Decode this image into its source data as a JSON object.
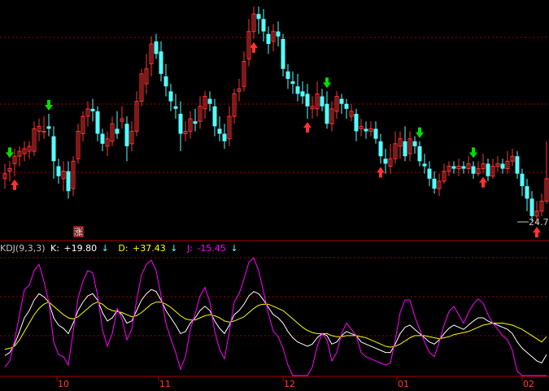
{
  "kdj": {
    "header": "KDJ(9,3,3)",
    "k_label": "K:",
    "k_value": "+19.80",
    "d_label": "D:",
    "d_value": "+37.43",
    "j_label": "J:",
    "j_value": "-15.45",
    "colors": {
      "k": "#ffffff",
      "d": "#ffff00",
      "j": "#ff00ff",
      "text": "#c0c0c0"
    }
  },
  "price": {
    "last_low_label": "24.7",
    "badge": "涨",
    "colors": {
      "up": "#ff3232",
      "down": "#54ffff",
      "buy_arrow": "#ff3232",
      "sell_arrow": "#00e000",
      "grid": "#a00000"
    }
  },
  "axis": {
    "months": [
      "10",
      "11",
      "12",
      "01",
      "02"
    ],
    "month_color": "#ff3c3c"
  },
  "chart_data": [
    {
      "type": "candlestick",
      "title": "",
      "candles": [
        {
          "o": 207,
          "c": 209,
          "h": 213,
          "l": 203
        },
        {
          "o": 210,
          "c": 211,
          "h": 214,
          "l": 206
        },
        {
          "o": 213,
          "c": 216,
          "h": 219,
          "l": 208
        },
        {
          "o": 216,
          "c": 218,
          "h": 220,
          "l": 212
        },
        {
          "o": 217,
          "c": 219,
          "h": 222,
          "l": 214
        },
        {
          "o": 218,
          "c": 220,
          "h": 222,
          "l": 215
        },
        {
          "o": 218,
          "c": 227,
          "h": 230,
          "l": 216
        },
        {
          "o": 226,
          "c": 228,
          "h": 231,
          "l": 222
        },
        {
          "o": 226,
          "c": 226,
          "h": 232,
          "l": 223
        },
        {
          "o": 228,
          "c": 227,
          "h": 233,
          "l": 224
        },
        {
          "o": 224,
          "c": 214,
          "h": 228,
          "l": 207
        },
        {
          "o": 212,
          "c": 208,
          "h": 215,
          "l": 205
        },
        {
          "o": 207,
          "c": 210,
          "h": 214,
          "l": 202
        },
        {
          "o": 210,
          "c": 202,
          "h": 214,
          "l": 199
        },
        {
          "o": 203,
          "c": 214,
          "h": 216,
          "l": 200
        },
        {
          "o": 215,
          "c": 226,
          "h": 229,
          "l": 213
        },
        {
          "o": 225,
          "c": 232,
          "h": 234,
          "l": 222
        },
        {
          "o": 232,
          "c": 235,
          "h": 238,
          "l": 228
        },
        {
          "o": 235,
          "c": 234,
          "h": 239,
          "l": 230
        },
        {
          "o": 234,
          "c": 225,
          "h": 236,
          "l": 222
        },
        {
          "o": 225,
          "c": 221,
          "h": 227,
          "l": 218
        },
        {
          "o": 220,
          "c": 223,
          "h": 226,
          "l": 216
        },
        {
          "o": 222,
          "c": 229,
          "h": 232,
          "l": 220
        },
        {
          "o": 227,
          "c": 225,
          "h": 234,
          "l": 223
        },
        {
          "o": 230,
          "c": 231,
          "h": 236,
          "l": 227
        },
        {
          "o": 229,
          "c": 220,
          "h": 232,
          "l": 214
        },
        {
          "o": 221,
          "c": 226,
          "h": 230,
          "l": 218
        },
        {
          "o": 226,
          "c": 238,
          "h": 242,
          "l": 224
        },
        {
          "o": 238,
          "c": 249,
          "h": 251,
          "l": 236
        },
        {
          "o": 245,
          "c": 251,
          "h": 257,
          "l": 241
        },
        {
          "o": 253,
          "c": 261,
          "h": 264,
          "l": 248
        },
        {
          "o": 262,
          "c": 257,
          "h": 265,
          "l": 255
        },
        {
          "o": 258,
          "c": 249,
          "h": 262,
          "l": 246
        },
        {
          "o": 248,
          "c": 244,
          "h": 253,
          "l": 240
        },
        {
          "o": 242,
          "c": 238,
          "h": 245,
          "l": 234
        },
        {
          "o": 236,
          "c": 235,
          "h": 241,
          "l": 231
        },
        {
          "o": 233,
          "c": 225,
          "h": 238,
          "l": 218
        },
        {
          "o": 225,
          "c": 226,
          "h": 230,
          "l": 222
        },
        {
          "o": 226,
          "c": 231,
          "h": 234,
          "l": 223
        },
        {
          "o": 230,
          "c": 229,
          "h": 235,
          "l": 226
        },
        {
          "o": 230,
          "c": 236,
          "h": 240,
          "l": 227
        },
        {
          "o": 235,
          "c": 240,
          "h": 242,
          "l": 231
        },
        {
          "o": 239,
          "c": 237,
          "h": 242,
          "l": 234
        },
        {
          "o": 236,
          "c": 228,
          "h": 239,
          "l": 224
        },
        {
          "o": 227,
          "c": 225,
          "h": 232,
          "l": 222
        },
        {
          "o": 225,
          "c": 222,
          "h": 229,
          "l": 219
        },
        {
          "o": 223,
          "c": 232,
          "h": 236,
          "l": 220
        },
        {
          "o": 232,
          "c": 241,
          "h": 243,
          "l": 229
        },
        {
          "o": 242,
          "c": 243,
          "h": 247,
          "l": 238
        },
        {
          "o": 244,
          "c": 254,
          "h": 258,
          "l": 242
        },
        {
          "o": 255,
          "c": 266,
          "h": 271,
          "l": 252
        },
        {
          "o": 266,
          "c": 273,
          "h": 276,
          "l": 263
        },
        {
          "o": 273,
          "c": 271,
          "h": 276,
          "l": 265
        },
        {
          "o": 271,
          "c": 266,
          "h": 275,
          "l": 262
        },
        {
          "o": 265,
          "c": 261,
          "h": 268,
          "l": 257
        },
        {
          "o": 262,
          "c": 266,
          "h": 269,
          "l": 258
        },
        {
          "o": 266,
          "c": 264,
          "h": 270,
          "l": 260
        },
        {
          "o": 263,
          "c": 251,
          "h": 265,
          "l": 248
        },
        {
          "o": 250,
          "c": 247,
          "h": 253,
          "l": 243
        },
        {
          "o": 246,
          "c": 245,
          "h": 250,
          "l": 241
        },
        {
          "o": 244,
          "c": 241,
          "h": 249,
          "l": 238
        },
        {
          "o": 242,
          "c": 240,
          "h": 246,
          "l": 237
        },
        {
          "o": 241,
          "c": 236,
          "h": 245,
          "l": 231
        },
        {
          "o": 235,
          "c": 236,
          "h": 240,
          "l": 231
        },
        {
          "o": 235,
          "c": 241,
          "h": 246,
          "l": 232
        },
        {
          "o": 240,
          "c": 236,
          "h": 243,
          "l": 234
        },
        {
          "o": 237,
          "c": 229,
          "h": 242,
          "l": 227
        },
        {
          "o": 229,
          "c": 235,
          "h": 238,
          "l": 226
        },
        {
          "o": 234,
          "c": 240,
          "h": 242,
          "l": 231
        },
        {
          "o": 239,
          "c": 237,
          "h": 241,
          "l": 233
        },
        {
          "o": 237,
          "c": 235,
          "h": 239,
          "l": 231
        },
        {
          "o": 232,
          "c": 234,
          "h": 237,
          "l": 230
        },
        {
          "o": 233,
          "c": 226,
          "h": 235,
          "l": 222
        },
        {
          "o": 227,
          "c": 228,
          "h": 231,
          "l": 224
        },
        {
          "o": 227,
          "c": 226,
          "h": 230,
          "l": 223
        },
        {
          "o": 226,
          "c": 227,
          "h": 230,
          "l": 224
        },
        {
          "o": 227,
          "c": 223,
          "h": 230,
          "l": 221
        },
        {
          "o": 222,
          "c": 216,
          "h": 225,
          "l": 213
        },
        {
          "o": 215,
          "c": 213,
          "h": 219,
          "l": 209
        },
        {
          "o": 212,
          "c": 215,
          "h": 221,
          "l": 209
        },
        {
          "o": 215,
          "c": 221,
          "h": 226,
          "l": 213
        },
        {
          "o": 220,
          "c": 223,
          "h": 226,
          "l": 215
        },
        {
          "o": 222,
          "c": 216,
          "h": 228,
          "l": 214
        },
        {
          "o": 217,
          "c": 223,
          "h": 226,
          "l": 214
        },
        {
          "o": 222,
          "c": 220,
          "h": 224,
          "l": 217
        },
        {
          "o": 220,
          "c": 214,
          "h": 222,
          "l": 212
        },
        {
          "o": 213,
          "c": 212,
          "h": 217,
          "l": 209
        },
        {
          "o": 211,
          "c": 207,
          "h": 214,
          "l": 204
        },
        {
          "o": 207,
          "c": 203,
          "h": 210,
          "l": 201
        },
        {
          "o": 203,
          "c": 206,
          "h": 209,
          "l": 200
        },
        {
          "o": 206,
          "c": 210,
          "h": 213,
          "l": 205
        },
        {
          "o": 210,
          "c": 212,
          "h": 214,
          "l": 208
        },
        {
          "o": 212,
          "c": 211,
          "h": 214,
          "l": 209
        },
        {
          "o": 211,
          "c": 212,
          "h": 215,
          "l": 208
        },
        {
          "o": 212,
          "c": 211,
          "h": 214,
          "l": 209
        },
        {
          "o": 211,
          "c": 213,
          "h": 216,
          "l": 209
        },
        {
          "o": 212,
          "c": 209,
          "h": 214,
          "l": 207
        },
        {
          "o": 209,
          "c": 211,
          "h": 214,
          "l": 208
        },
        {
          "o": 211,
          "c": 213,
          "h": 217,
          "l": 209
        },
        {
          "o": 213,
          "c": 208,
          "h": 215,
          "l": 206
        },
        {
          "o": 208,
          "c": 212,
          "h": 215,
          "l": 207
        },
        {
          "o": 212,
          "c": 213,
          "h": 216,
          "l": 210
        },
        {
          "o": 213,
          "c": 211,
          "h": 215,
          "l": 209
        },
        {
          "o": 211,
          "c": 214,
          "h": 218,
          "l": 209
        },
        {
          "o": 214,
          "c": 216,
          "h": 219,
          "l": 212
        },
        {
          "o": 216,
          "c": 209,
          "h": 218,
          "l": 207
        },
        {
          "o": 209,
          "c": 204,
          "h": 211,
          "l": 200
        },
        {
          "o": 204,
          "c": 199,
          "h": 207,
          "l": 194
        },
        {
          "o": 199,
          "c": 192,
          "h": 202,
          "l": 190
        },
        {
          "o": 192,
          "c": 194,
          "h": 198,
          "l": 189
        },
        {
          "o": 194,
          "c": 198,
          "h": 201,
          "l": 192
        },
        {
          "o": 198,
          "c": 207,
          "h": 222,
          "l": 197
        },
        {
          "o": 207,
          "c": 211,
          "h": 216,
          "l": 205
        }
      ],
      "buy_signals": [
        2,
        51,
        62,
        77,
        98,
        109
      ],
      "sell_signals": [
        1,
        9,
        66,
        85,
        96
      ],
      "last_low_label": "24.7"
    },
    {
      "type": "line",
      "title": "KDJ(9,3,3)",
      "x": [
        0,
        1,
        2,
        3,
        4,
        5,
        6,
        7,
        8,
        9,
        10,
        11,
        12,
        13,
        14,
        15,
        16,
        17,
        18,
        19,
        20,
        21,
        22,
        23,
        24,
        25,
        26,
        27,
        28,
        29,
        30,
        31,
        32,
        33,
        34,
        35,
        36,
        37,
        38,
        39,
        40,
        41,
        42,
        43,
        44,
        45,
        46,
        47,
        48,
        49,
        50,
        51,
        52,
        53,
        54,
        55,
        56,
        57,
        58,
        59,
        60,
        61,
        62,
        63,
        64,
        65,
        66,
        67,
        68,
        69,
        70,
        71,
        72,
        73,
        74,
        75,
        76,
        77,
        78,
        79,
        80,
        81,
        82,
        83,
        84,
        85,
        86,
        87,
        88,
        89,
        90,
        91,
        92,
        93,
        94,
        95,
        96,
        97,
        98,
        99,
        100,
        101,
        102,
        103,
        104,
        105,
        106,
        107,
        108,
        109,
        110,
        111
      ],
      "series": [
        {
          "name": "K",
          "values": [
            19,
            22,
            30,
            42,
            55,
            62,
            72,
            78,
            75,
            70,
            55,
            48,
            45,
            40,
            50,
            62,
            70,
            76,
            78,
            72,
            60,
            52,
            55,
            62,
            58,
            50,
            52,
            62,
            72,
            78,
            82,
            80,
            72,
            62,
            55,
            48,
            40,
            42,
            50,
            55,
            62,
            66,
            62,
            52,
            45,
            40,
            48,
            58,
            62,
            68,
            76,
            80,
            78,
            72,
            65,
            58,
            55,
            50,
            42,
            36,
            32,
            30,
            28,
            30,
            36,
            40,
            38,
            30,
            32,
            38,
            42,
            40,
            38,
            32,
            30,
            28,
            26,
            24,
            22,
            22,
            30,
            40,
            46,
            48,
            44,
            40,
            36,
            32,
            30,
            34,
            40,
            45,
            48,
            46,
            44,
            48,
            52,
            55,
            55,
            52,
            50,
            48,
            46,
            44,
            40,
            32,
            26,
            22,
            18,
            14,
            12,
            20
          ]
        },
        {
          "name": "D",
          "values": [
            25,
            26,
            28,
            34,
            42,
            50,
            58,
            64,
            68,
            70,
            66,
            62,
            58,
            55,
            54,
            56,
            60,
            64,
            68,
            70,
            68,
            64,
            62,
            61,
            60,
            58,
            56,
            57,
            60,
            64,
            68,
            70,
            70,
            68,
            65,
            61,
            57,
            54,
            53,
            53,
            55,
            57,
            58,
            57,
            55,
            52,
            51,
            52,
            54,
            56,
            60,
            64,
            67,
            68,
            68,
            66,
            64,
            62,
            58,
            54,
            50,
            46,
            43,
            41,
            40,
            40,
            40,
            38,
            37,
            37,
            38,
            38,
            38,
            37,
            36,
            34,
            32,
            30,
            28,
            27,
            28,
            30,
            33,
            36,
            38,
            38,
            38,
            37,
            36,
            35,
            36,
            37,
            39,
            40,
            41,
            42,
            44,
            46,
            48,
            49,
            50,
            50,
            50,
            49,
            48,
            46,
            44,
            41,
            38,
            35,
            32,
            37
          ]
        },
        {
          "name": "J",
          "values": [
            8,
            14,
            34,
            58,
            82,
            86,
            100,
            106,
            90,
            70,
            32,
            20,
            18,
            10,
            42,
            74,
            90,
            100,
            98,
            76,
            44,
            28,
            40,
            64,
            54,
            34,
            44,
            72,
            96,
            106,
            110,
            100,
            76,
            50,
            35,
            22,
            6,
            18,
            44,
            59,
            76,
            84,
            70,
            42,
            25,
            16,
            42,
            70,
            78,
            92,
            108,
            112,
            100,
            80,
            59,
            42,
            37,
            26,
            10,
            0,
            0,
            0,
            0,
            8,
            28,
            40,
            34,
            14,
            22,
            40,
            50,
            44,
            38,
            22,
            18,
            16,
            14,
            12,
            10,
            12,
            34,
            60,
            72,
            72,
            56,
            44,
            32,
            22,
            18,
            32,
            48,
            61,
            66,
            58,
            50,
            60,
            68,
            73,
            69,
            58,
            50,
            44,
            38,
            34,
            24,
            4,
            0,
            0,
            0,
            0,
            0,
            0
          ]
        }
      ],
      "ylim": [
        0,
        110
      ]
    }
  ]
}
